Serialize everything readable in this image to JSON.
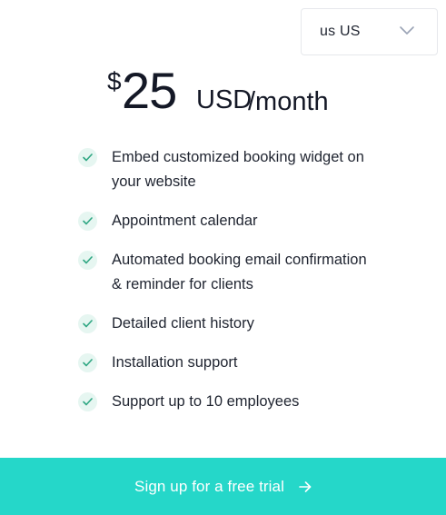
{
  "locale_select": {
    "value": "us US",
    "icon": "chevron-down-icon"
  },
  "price": {
    "currency_symbol": "$",
    "amount": "25",
    "currency_code": "USD",
    "period": "/month"
  },
  "features": [
    {
      "text": "Embed customized booking widget on your website",
      "icon": "check-icon"
    },
    {
      "text": "Appointment calendar",
      "icon": "check-icon"
    },
    {
      "text": "Automated booking email confirmation & reminder for clients",
      "icon": "check-icon"
    },
    {
      "text": "Detailed client history",
      "icon": "check-icon"
    },
    {
      "text": "Installation support",
      "icon": "check-icon"
    },
    {
      "text": "Support up to 10 employees",
      "icon": "check-icon"
    }
  ],
  "cta": {
    "label": "Sign up for a free trial",
    "icon": "arrow-right-icon"
  },
  "colors": {
    "accent": "#25d7c9",
    "check_bg": "#e6f6f1",
    "check_mark": "#2fa783",
    "text": "#1f2430"
  }
}
